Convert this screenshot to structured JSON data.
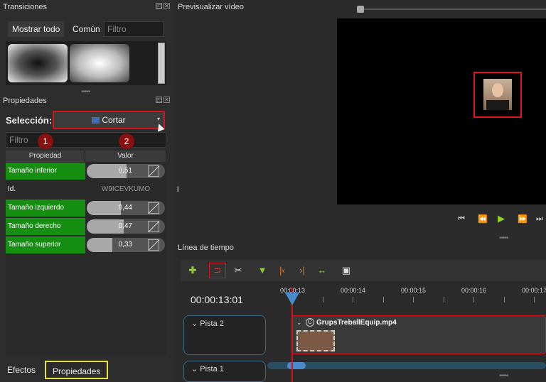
{
  "transitions": {
    "title": "Transiciones",
    "tabs": [
      "Mostrar todo",
      "Común"
    ],
    "filter_placeholder": "Filtro"
  },
  "properties": {
    "title": "Propiedades",
    "selection_label": "Selección:",
    "selection_value": "Cortar",
    "filter_placeholder": "Filtro",
    "badges": [
      "1",
      "2"
    ],
    "columns": [
      "Propiedad",
      "Valor"
    ],
    "rows": [
      {
        "name": "Tamaño inferior",
        "value": "0,51",
        "fraction": 0.51
      },
      {
        "name": "Id.",
        "value": "W9ICEVKUMO"
      },
      {
        "name": "Tamaño izquierdo",
        "value": "0,44",
        "fraction": 0.44
      },
      {
        "name": "Tamaño derecho",
        "value": "0,47",
        "fraction": 0.47
      },
      {
        "name": "Tamaño superior",
        "value": "0,33",
        "fraction": 0.33
      }
    ]
  },
  "bottom_tabs": [
    "Efectos",
    "Propiedades"
  ],
  "preview": {
    "title": "Previsualizar vídeo"
  },
  "timeline": {
    "title": "Línea de tiempo",
    "timecode": "00:00:13:01",
    "ticks": [
      "00:00:13",
      "00:00:14",
      "00:00:15",
      "00:00:16",
      "00:00:17"
    ],
    "tracks": [
      "Pista 2",
      "Pista 1"
    ],
    "clip_name": "GrupsTreballEquip.mp4",
    "clip_badge": "C"
  },
  "colors": {
    "green_row": "#168e12",
    "highlight_red": "#d0161b",
    "highlight_yellow": "#e8e040"
  },
  "icons": [
    "add-icon",
    "magnet-icon",
    "razor-icon",
    "marker-icon",
    "previous-marker-icon",
    "next-marker-icon",
    "center-playhead-icon",
    "zoom-icon"
  ]
}
